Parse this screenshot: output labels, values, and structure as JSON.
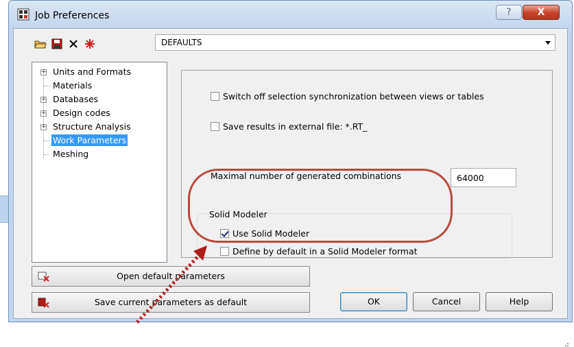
{
  "window": {
    "title": "Job Preferences",
    "help_symbol": "?",
    "close_symbol": "X"
  },
  "toolbar": {
    "icons": [
      "open-folder-icon",
      "save-icon",
      "delete-icon",
      "reset-icon"
    ]
  },
  "preset": {
    "selected": "DEFAULTS"
  },
  "tree": {
    "items": [
      {
        "label": "Units and Formats",
        "expandable": true,
        "selected": false
      },
      {
        "label": "Materials",
        "expandable": false,
        "selected": false
      },
      {
        "label": "Databases",
        "expandable": true,
        "selected": false
      },
      {
        "label": "Design codes",
        "expandable": true,
        "selected": false
      },
      {
        "label": "Structure Analysis",
        "expandable": true,
        "selected": false
      },
      {
        "label": "Work Parameters",
        "expandable": false,
        "selected": true
      },
      {
        "label": "Meshing",
        "expandable": false,
        "selected": false
      }
    ]
  },
  "panel": {
    "switch_off_sync": {
      "label": "Switch off selection synchronization between views or tables",
      "checked": false
    },
    "save_results": {
      "label": "Save results in external file: *.RT_",
      "checked": false
    },
    "max_combinations_label": "Maximal number of generated combinations",
    "max_combinations_value": "64000",
    "solid_modeler": {
      "group_title": "Solid Modeler",
      "use_solid_modeler": {
        "label": "Use Solid Modeler",
        "checked": true
      },
      "define_by_default": {
        "label": "Define by default in a Solid Modeler format",
        "checked": false
      }
    }
  },
  "buttons": {
    "open_default": "Open default parameters",
    "save_default": "Save current parameters as default",
    "ok": "OK",
    "cancel": "Cancel",
    "help": "Help"
  },
  "colors": {
    "selection": "#3399ff",
    "annotation": "#b84a3d",
    "window_frame": "#c3d6ec"
  }
}
